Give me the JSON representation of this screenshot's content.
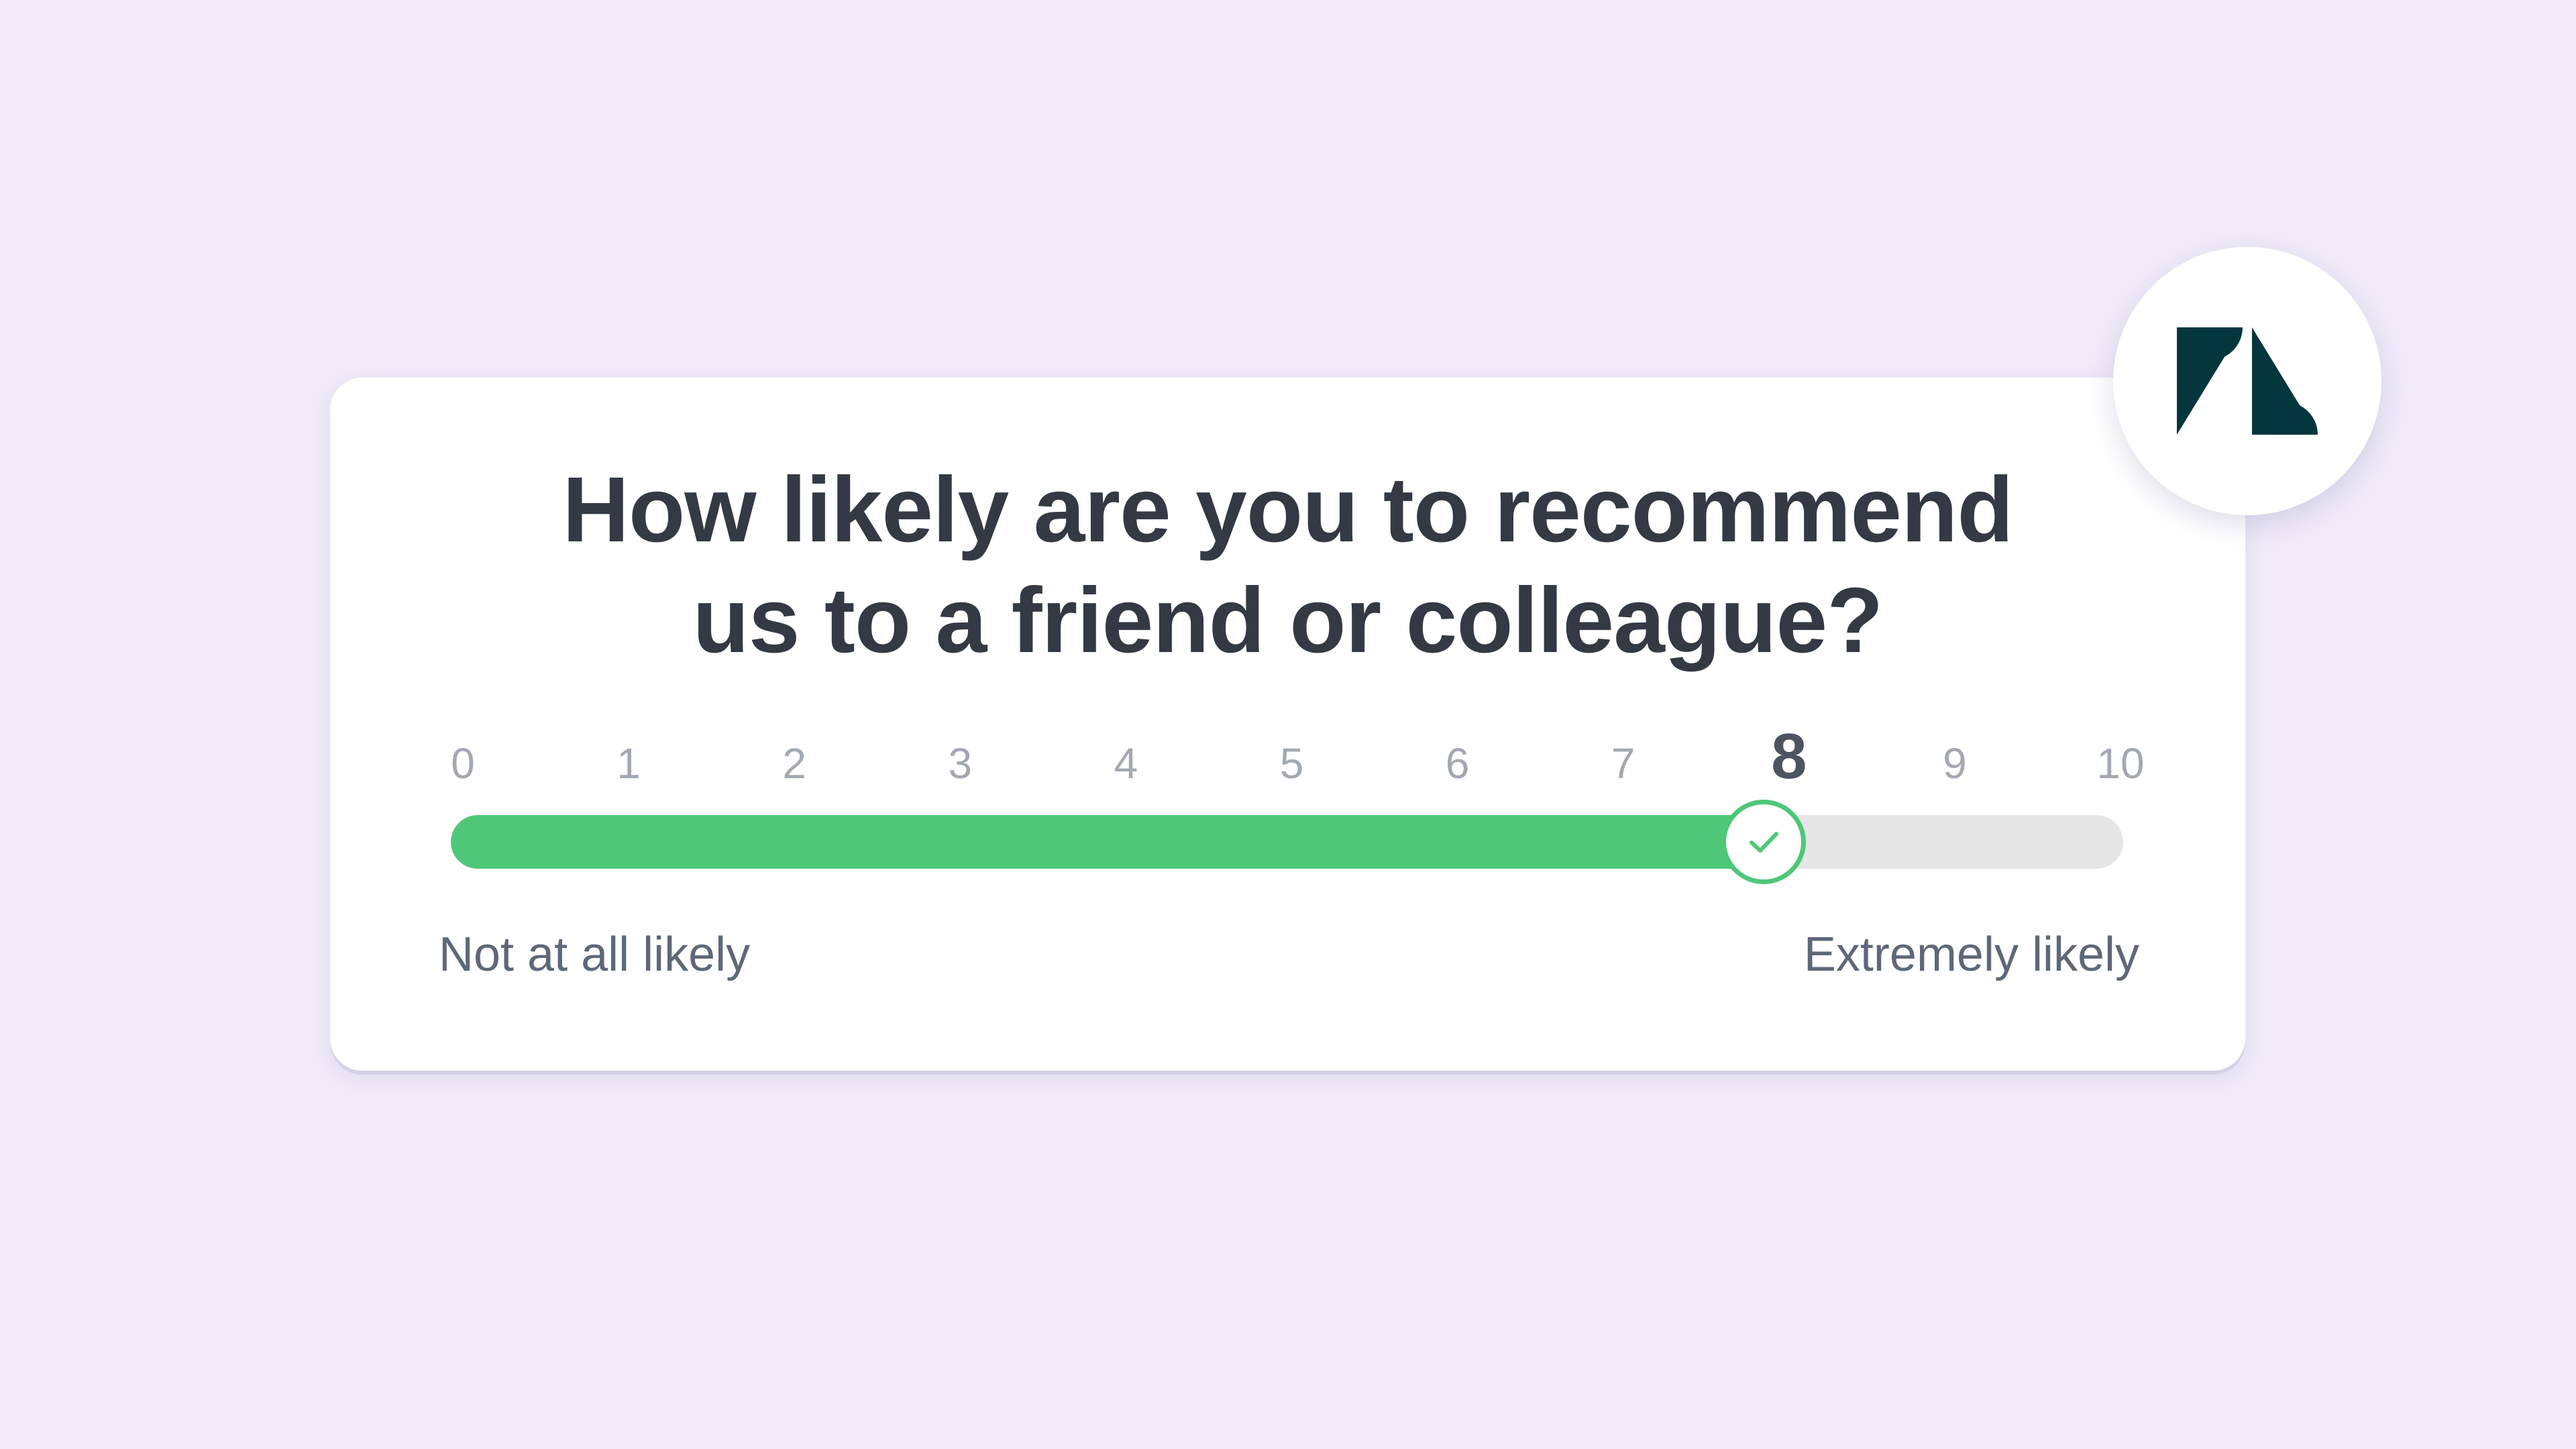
{
  "survey": {
    "question_line1": "How likely are you to recommend",
    "question_line2": "us to a friend or colleague?",
    "scale": [
      "0",
      "1",
      "2",
      "3",
      "4",
      "5",
      "6",
      "7",
      "8",
      "9",
      "10"
    ],
    "min": 0,
    "max": 10,
    "selected_value": 8,
    "selected_fraction": 0.785,
    "low_label": "Not at all likely",
    "high_label": "Extremely likely",
    "thumb_icon": "checkmark-icon"
  },
  "brand": {
    "logo_icon": "zendesk-logo-icon"
  },
  "colors": {
    "background": "#EFEBF9",
    "card": "#FFFFFF",
    "question_text": "#343A44",
    "accent_green": "#4FC779",
    "track": "#E6E6E6",
    "scale_number": "#A3A8B2",
    "label_text": "#5E6878",
    "logo": "#03363D"
  }
}
